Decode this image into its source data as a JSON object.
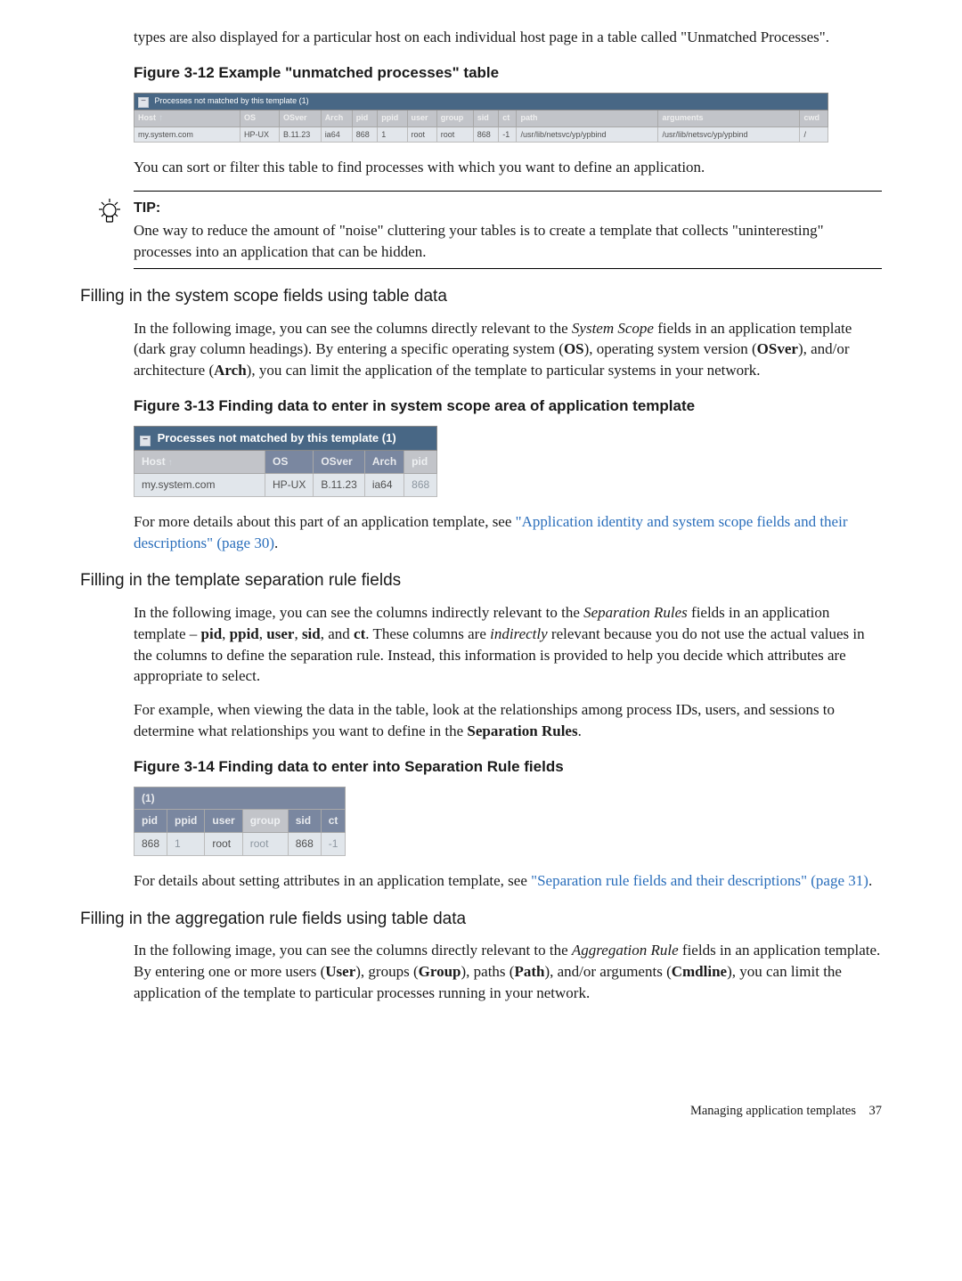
{
  "intro": "types are also displayed for a particular host on each individual host page in a table called \"Unmatched Processes\".",
  "fig12": {
    "title": "Figure 3-12 Example \"unmatched processes\" table",
    "table_title": "Processes not matched by this template (1)",
    "headers": [
      "Host",
      "OS",
      "OSver",
      "Arch",
      "pid",
      "ppid",
      "user",
      "group",
      "sid",
      "ct",
      "path",
      "arguments",
      "cwd"
    ],
    "row": [
      "my.system.com",
      "HP-UX",
      "B.11.23",
      "ia64",
      "868",
      "1",
      "root",
      "root",
      "868",
      "-1",
      "/usr/lib/netsvc/yp/ypbind",
      "/usr/lib/netsvc/yp/ypbind",
      "/"
    ]
  },
  "p_sort": "You can sort or filter this table to find processes with which you want to define an application.",
  "tip": {
    "label": "TIP:",
    "body": "One way to reduce the amount of \"noise\" cluttering your tables is to create a template that collects \"uninteresting\" processes into an application that can be hidden."
  },
  "h_scope": "Filling in the system scope fields using table data",
  "p_scope_pre": "In the following image, you can see the columns directly relevant to the ",
  "p_scope_em": "System Scope",
  "p_scope_mid": " fields in an application template (dark gray column headings). By entering a specific operating system (",
  "b_os": "OS",
  "p_scope_mid2": "), operating system version (",
  "b_osver": "OSver",
  "p_scope_mid3": "), and/or architecture (",
  "b_arch": "Arch",
  "p_scope_end": "), you can limit the application of the template to particular systems in your network.",
  "fig13": {
    "title": "Figure 3-13 Finding data to enter in system scope area of application template",
    "table_title": "Processes not matched by this template (1)",
    "headers": [
      "Host",
      "OS",
      "OSver",
      "Arch",
      "pid"
    ],
    "row": [
      "my.system.com",
      "HP-UX",
      "B.11.23",
      "ia64",
      "868"
    ]
  },
  "p_scope_link_pre": "For more details about this part of an application template, see ",
  "p_scope_link": "\"Application identity and system scope fields and their descriptions\" (page 30)",
  "p_scope_link_post": ".",
  "h_sep": "Filling in the template separation rule fields",
  "p_sep1_pre": "In the following image, you can see the columns indirectly relevant to the ",
  "p_sep1_em": "Separation Rules",
  "p_sep1_mid": " fields in an application template – ",
  "b_pid": "pid",
  "b_ppid": "ppid",
  "b_user": "user",
  "b_sid": "sid",
  "b_ct": "ct",
  "p_sep1_mid2": ". These columns are ",
  "p_sep1_em2": "indirectly",
  "p_sep1_end": " relevant because you do not use the actual values in the columns to define the separation rule. Instead, this information is provided to help you decide which attributes are appropriate to select.",
  "p_sep2_pre": "For example, when viewing the data in the table, look at the relationships among process IDs, users, and sessions to determine what relationships you want to define in the ",
  "b_sep_rules": "Separation Rules",
  "p_sep2_end": ".",
  "fig14": {
    "title": "Figure 3-14 Finding data to enter into Separation Rule fields",
    "super": "(1)",
    "headers": [
      "pid",
      "ppid",
      "user",
      "group",
      "sid",
      "ct"
    ],
    "row": [
      "868",
      "1",
      "root",
      "root",
      "868",
      "-1"
    ]
  },
  "p_sep_link_pre": "For details about setting attributes in an application template, see ",
  "p_sep_link": "\"Separation rule fields and their descriptions\" (page 31)",
  "p_sep_link_post": ".",
  "h_agg": "Filling in the aggregation rule fields using table data",
  "p_agg_pre": "In the following image, you can see the columns directly relevant to the ",
  "p_agg_em": "Aggregation Rule",
  "p_agg_mid": " fields in an application template. By entering one or more users (",
  "b_user2": "User",
  "p_agg_mid2": "), groups (",
  "b_group": "Group",
  "p_agg_mid3": "), paths (",
  "b_path": "Path",
  "p_agg_mid4": "), and/or arguments (",
  "b_cmdline": "Cmdline",
  "p_agg_end": "), you can limit the application of the template to particular processes running in your network.",
  "footer_text": "Managing application templates",
  "footer_page": "37",
  "comma_sep": ", ",
  "and_sep": ", and "
}
